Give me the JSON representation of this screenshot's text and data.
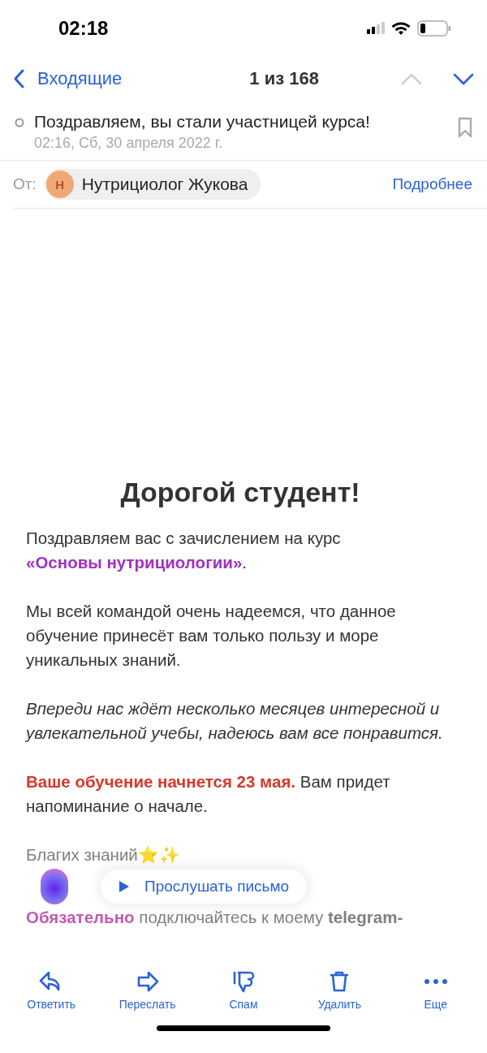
{
  "status_bar": {
    "time": "02:18"
  },
  "nav": {
    "back_label": "Входящие",
    "counter": "1 из 168",
    "arrows": [
      {
        "kind": "up",
        "disabled": true
      },
      {
        "kind": "down",
        "disabled": false
      }
    ]
  },
  "message": {
    "subject": "Поздравляем, вы стали участницей курса!",
    "date": "02:16, Сб, 30 апреля 2022 г.",
    "from_label": "От:",
    "sender_initial": "Н",
    "sender_name": "Нутрициолог Жукова",
    "details_link": "Подробнее"
  },
  "body": {
    "heading": "Дорогой студент!",
    "paragraphs": [
      {
        "kind": "purple",
        "text": "Поздравляем вас с зачислением на курс **«Основы нутрициологии»**."
      },
      {
        "kind": "plain",
        "text": "Мы всей командой очень надеемся, что данное обучение принесёт вам только пользу и море уникальных знаний."
      },
      {
        "kind": "italic",
        "text": "Впереди нас ждёт несколько месяцев интересной и увлекательной учебы, надеюсь вам все понравится."
      },
      {
        "kind": "red",
        "text": "**Ваше обучение начнется 23 мая.** Вам придет напоминание о начале."
      },
      {
        "kind": "faded",
        "text": "Благих знаний⭐✨"
      },
      {
        "kind": "faded",
        "text": "**Обязательно** подключайтесь к моему **telegram-**"
      }
    ]
  },
  "listen_button": {
    "label": "Прослушать письмо"
  },
  "toolbar": [
    {
      "kind": "reply",
      "label": "Ответить"
    },
    {
      "kind": "forward",
      "label": "Переслать"
    },
    {
      "kind": "spam",
      "label": "Спам"
    },
    {
      "kind": "delete",
      "label": "Удалить"
    },
    {
      "kind": "more",
      "label": "Еще"
    }
  ]
}
